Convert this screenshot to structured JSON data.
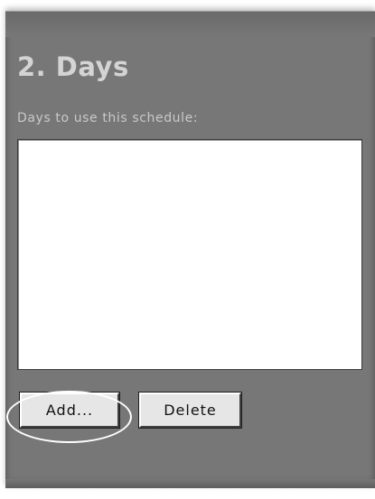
{
  "section": {
    "title": "2. Days",
    "subtitle": "Days to use this schedule:"
  },
  "days_list": {
    "items": []
  },
  "buttons": {
    "add_label": "Add...",
    "delete_label": "Delete"
  },
  "colors": {
    "panel_background": "#777777",
    "title_text": "#d4d4d4",
    "button_face": "#e6e6e6",
    "highlight_annotation": "#ffffff"
  }
}
